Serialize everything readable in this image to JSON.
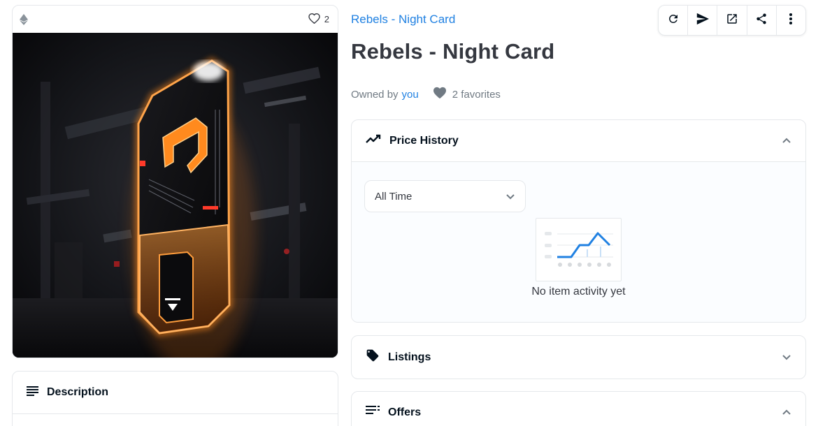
{
  "card": {
    "favorites_count": "2"
  },
  "description": {
    "title": "Description"
  },
  "item": {
    "collection_name": "Rebels - Night Card",
    "title": "Rebels - Night Card",
    "owned_by_label": "Owned by",
    "owner": "you",
    "favorites": "2 favorites"
  },
  "actions": [
    "refresh-icon",
    "transfer-icon",
    "open-external-icon",
    "share-icon",
    "more-icon"
  ],
  "price_history": {
    "title": "Price History",
    "period_select": "All Time",
    "empty_text": "No item activity yet"
  },
  "listings": {
    "title": "Listings"
  },
  "offers": {
    "title": "Offers"
  },
  "colors": {
    "accent": "#2081e2",
    "text": "#353840",
    "muted": "#707a83",
    "border": "#e5e8eb",
    "glow": "#ff8a1e"
  }
}
